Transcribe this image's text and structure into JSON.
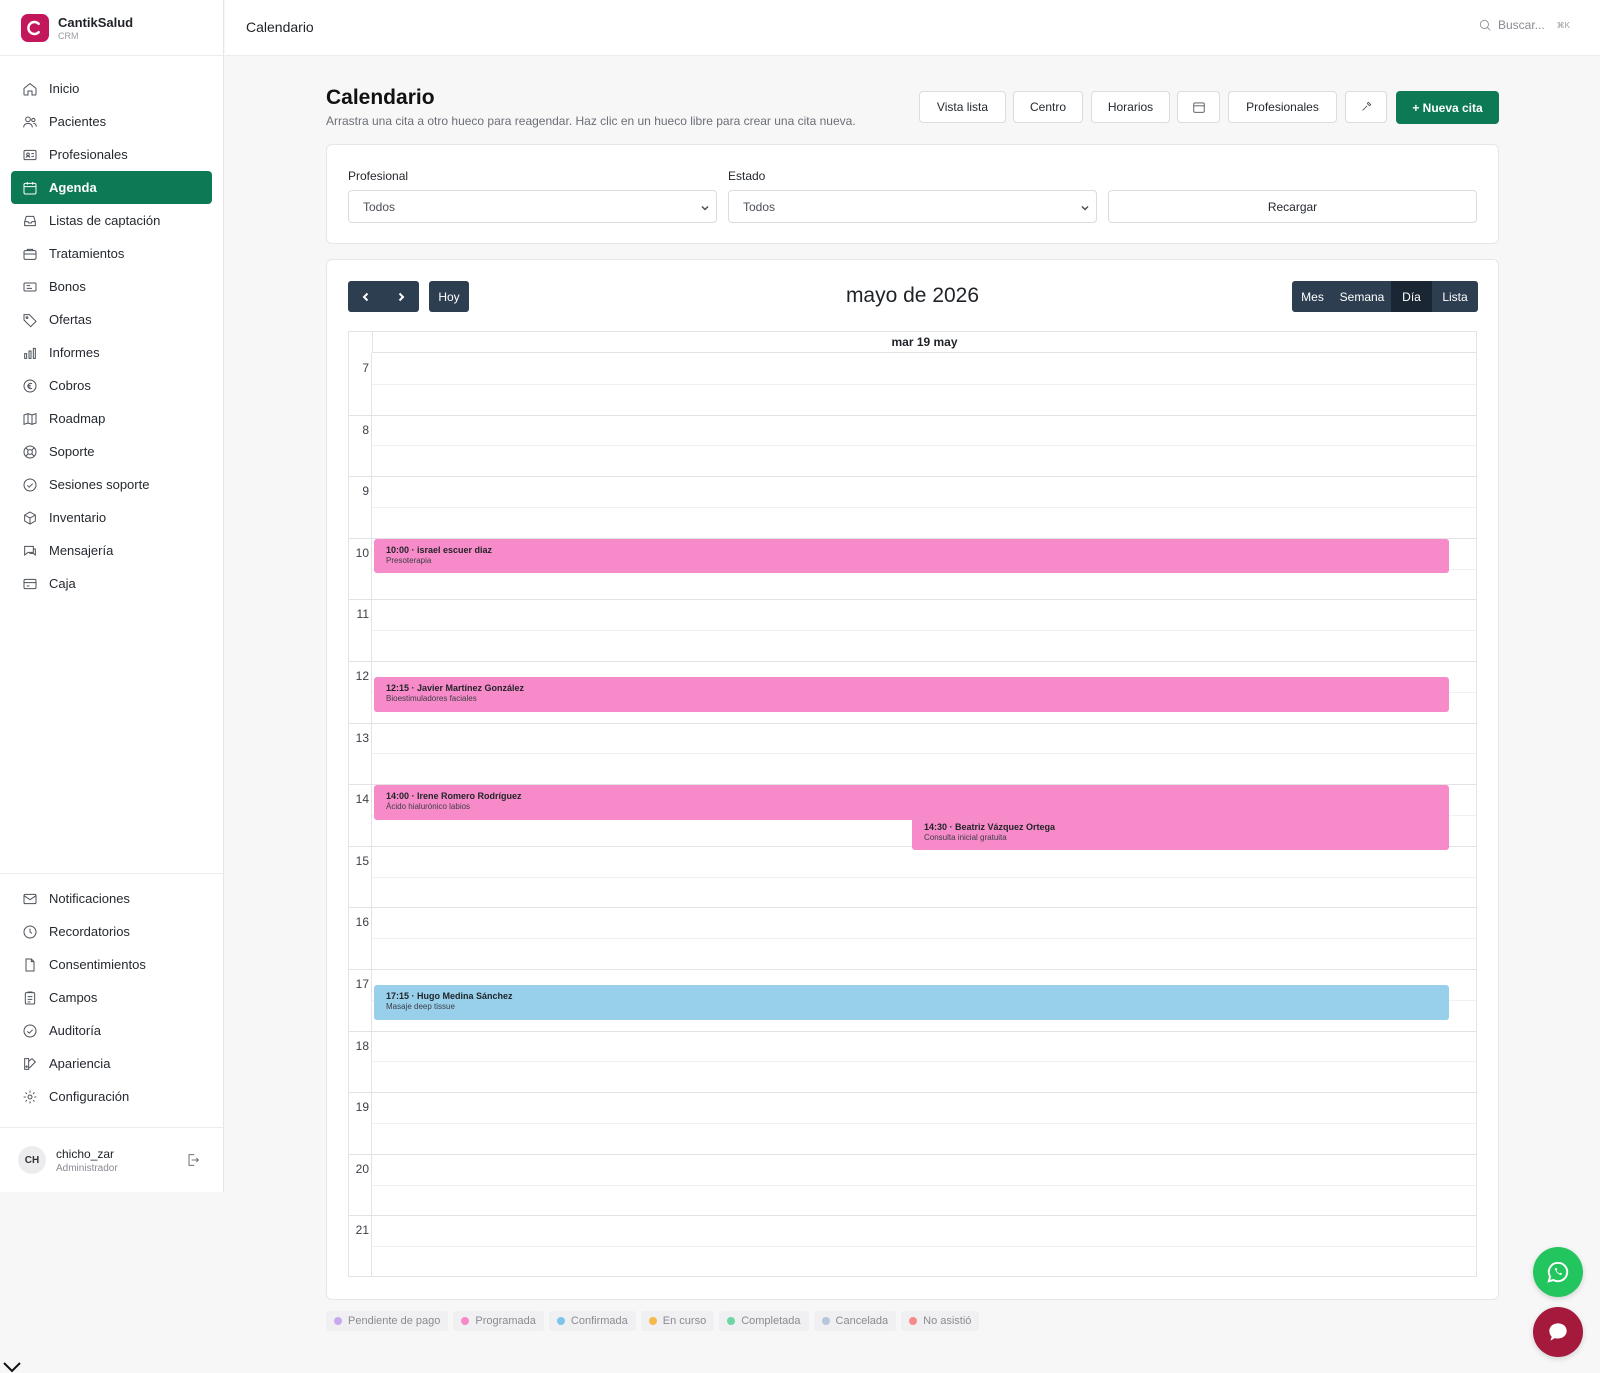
{
  "brand": {
    "name": "CantikSalud",
    "sub": "CRM"
  },
  "sidebar": {
    "items": [
      {
        "label": "Inicio",
        "icon": "home-icon"
      },
      {
        "label": "Pacientes",
        "icon": "users-icon"
      },
      {
        "label": "Profesionales",
        "icon": "id-card-icon"
      },
      {
        "label": "Agenda",
        "icon": "calendar-icon",
        "active": true
      },
      {
        "label": "Listas de captación",
        "icon": "inbox-icon"
      },
      {
        "label": "Tratamientos",
        "icon": "briefcase-icon"
      },
      {
        "label": "Bonos",
        "icon": "ticket-icon"
      },
      {
        "label": "Ofertas",
        "icon": "tag-icon"
      },
      {
        "label": "Informes",
        "icon": "bar-chart-icon"
      },
      {
        "label": "Cobros",
        "icon": "euro-icon"
      },
      {
        "label": "Roadmap",
        "icon": "map-icon"
      },
      {
        "label": "Soporte",
        "icon": "lifebuoy-icon"
      },
      {
        "label": "Sesiones soporte",
        "icon": "check-circle-icon"
      },
      {
        "label": "Inventario",
        "icon": "box-icon"
      },
      {
        "label": "Mensajería",
        "icon": "message-icon"
      },
      {
        "label": "Caja",
        "icon": "credit-card-icon"
      }
    ],
    "bottom_items": [
      {
        "label": "Notificaciones",
        "icon": "mail-icon"
      },
      {
        "label": "Recordatorios",
        "icon": "clock-icon"
      },
      {
        "label": "Consentimientos",
        "icon": "file-icon"
      },
      {
        "label": "Campos",
        "icon": "clipboard-icon"
      },
      {
        "label": "Auditoría",
        "icon": "check-circle-icon"
      },
      {
        "label": "Apariencia",
        "icon": "palette-icon"
      },
      {
        "label": "Configuración",
        "icon": "gear-icon"
      }
    ]
  },
  "user": {
    "initials": "CH",
    "name": "chicho_zar",
    "role": "Administrador"
  },
  "topbar": {
    "title": "Calendario",
    "search_placeholder": "Buscar...",
    "shortcut": "⌘K"
  },
  "header": {
    "title": "Calendario",
    "subtitle": "Arrastra una cita a otro hueco para reagendar. Haz clic en un hueco libre para crear una cita nueva.",
    "buttons": {
      "list_view": "Vista lista",
      "center": "Centro",
      "schedules": "Horarios",
      "professionals": "Profesionales",
      "new_appointment": "+ Nueva cita"
    }
  },
  "filters": {
    "professional_label": "Profesional",
    "professional_value": "Todos",
    "status_label": "Estado",
    "status_value": "Todos",
    "reload": "Recargar"
  },
  "calendar": {
    "title": "mayo de 2026",
    "today": "Hoy",
    "views": {
      "month": "Mes",
      "week": "Semana",
      "day": "Día",
      "list": "Lista"
    },
    "active_view": "Día",
    "day_header": "mar 19 may",
    "hours": [
      "7",
      "8",
      "9",
      "10",
      "11",
      "12",
      "13",
      "14",
      "15",
      "16",
      "17",
      "18",
      "19",
      "20",
      "21"
    ],
    "events": [
      {
        "title": "10:00 · israel escuer diaz",
        "treatment": "Presoterapia",
        "color": "#f78ac8"
      },
      {
        "title": "12:15 · Javier Martínez González",
        "treatment": "Bioestimuladores faciales",
        "color": "#f78ac8"
      },
      {
        "title": "14:00 · Irene Romero Rodríguez",
        "treatment": "Ácido hialurónico labios",
        "color": "#f78ac8"
      },
      {
        "title": "14:30 · Beatriz Vázquez Ortega",
        "treatment": "Consulta inicial gratuita",
        "color": "#f78ac8"
      },
      {
        "title": "17:15 · Hugo Medina Sánchez",
        "treatment": "Masaje deep tissue",
        "color": "#98cfea"
      }
    ]
  },
  "legend": [
    {
      "label": "Pendiente de pago",
      "color": "#c9a8f0"
    },
    {
      "label": "Programada",
      "color": "#f78ac8"
    },
    {
      "label": "Confirmada",
      "color": "#7ec4ea"
    },
    {
      "label": "En curso",
      "color": "#f5b84d"
    },
    {
      "label": "Completada",
      "color": "#6fd6a3"
    },
    {
      "label": "Cancelada",
      "color": "#b8c6dc"
    },
    {
      "label": "No asistió",
      "color": "#f58a8a"
    }
  ],
  "colors": {
    "accent": "#0d7a55",
    "dark": "#2c3e50",
    "brand": "#c2185b"
  }
}
